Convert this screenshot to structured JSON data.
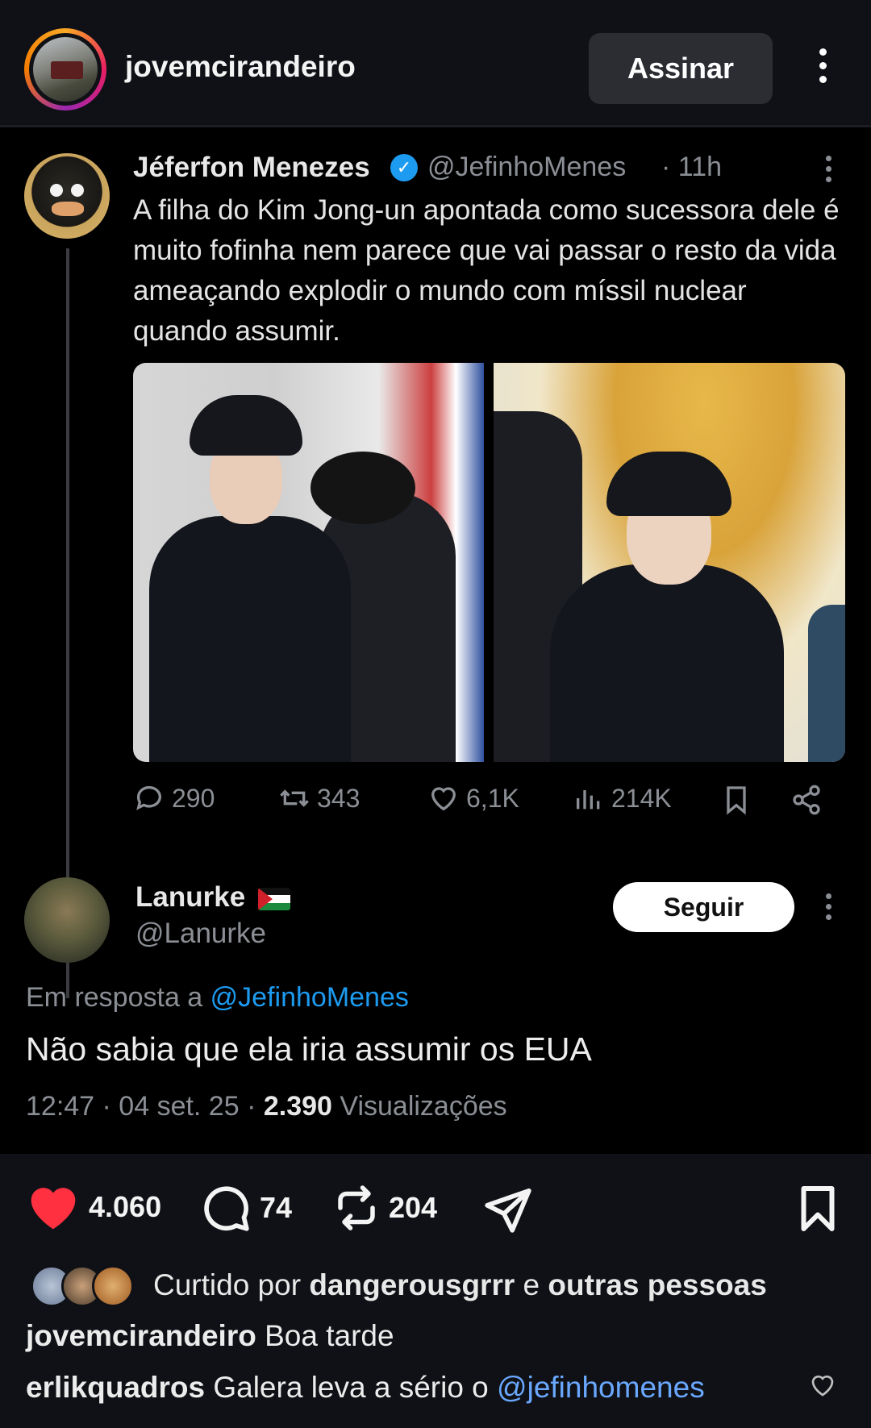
{
  "header": {
    "username": "jovemcirandeiro",
    "subscribe_label": "Assinar"
  },
  "tweet": {
    "author_name": "Jéferfon Menezes",
    "author_handle": "@JefinhoMenes",
    "time": "· 11h",
    "text": "A filha do Kim Jong-un apontada como sucessora dele é muito fofinha nem parece que vai passar o resto da vida ameaçando explodir o mundo com míssil nuclear quando assumir.",
    "stats": {
      "replies": "290",
      "retweets": "343",
      "likes": "6,1K",
      "views": "214K"
    }
  },
  "reply": {
    "author_name": "Lanurke",
    "author_handle": "@Lanurke",
    "follow_label": "Seguir",
    "in_reply_prefix": "Em resposta a",
    "in_reply_mention": "@JefinhoMenes",
    "text": "Não sabia que ela iria assumir os EUA",
    "meta_time": "12:47 · 04 set. 25 · ",
    "meta_views": "2.390",
    "meta_views_label": " Visualizações"
  },
  "ig_actions": {
    "likes": "4.060",
    "comments": "74",
    "reposts": "204"
  },
  "liked_by": {
    "prefix": "Curtido por ",
    "user": "dangerousgrrr",
    "middle": " e ",
    "others": "outras pessoas"
  },
  "caption": {
    "user": "jovemcirandeiro",
    "text": " Boa tarde"
  },
  "comment": {
    "user": "erlikquadros",
    "text": " Galera leva a sério o ",
    "mention": "@jefinhomenes"
  },
  "colors": {
    "background": "#0f1116",
    "post_background": "#000000",
    "like_red": "#ff3040",
    "link_blue": "#1d9bf0",
    "verified_blue": "#1d9bf0"
  }
}
